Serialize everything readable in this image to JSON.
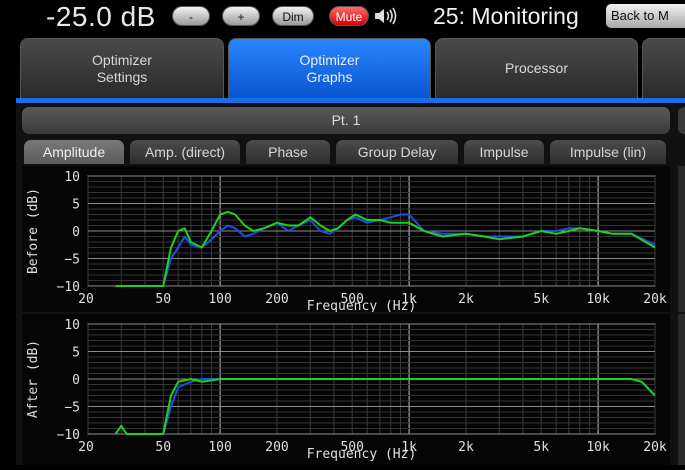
{
  "topbar": {
    "volume": "-25.0 dB",
    "minus_label": "-",
    "plus_label": "+",
    "dim_label": "Dim",
    "mute_label": "Mute",
    "speaker_icon": "speaker-volume-icon",
    "title": "25: Monitoring",
    "back_label": "Back to M"
  },
  "tabs": [
    {
      "line1": "Optimizer",
      "line2": "Settings"
    },
    {
      "line1": "Optimizer",
      "line2": "Graphs"
    },
    {
      "line1": "Processor",
      "line2": ""
    }
  ],
  "point_label": "Pt. 1",
  "subtabs": [
    "Amplitude",
    "Amp. (direct)",
    "Phase",
    "Group Delay",
    "Impulse",
    "Impulse (lin)"
  ],
  "colors": {
    "before_green": "#1fd11f",
    "after_green": "#1fd11f",
    "blue": "#1f4fe0",
    "grid": "#3a3a3a",
    "grid_major": "#bdbdbd",
    "accent": "#1a6ee8"
  },
  "charts": [
    {
      "ylabel": "Before (dB)",
      "xlabel": "Frequency (Hz)",
      "yticks": [
        "10",
        "5",
        "0",
        "−5",
        "−10"
      ],
      "xticks": [
        "20",
        "50",
        "100",
        "200",
        "500",
        "1k",
        "2k",
        "5k",
        "10k",
        "20k"
      ]
    },
    {
      "ylabel": "After (dB)",
      "xlabel": "Frequency (Hz)",
      "yticks": [
        "10",
        "5",
        "0",
        "−5",
        "−10"
      ],
      "xticks": [
        "20",
        "50",
        "100",
        "200",
        "500",
        "1k",
        "2k",
        "5k",
        "10k",
        "20k"
      ]
    }
  ],
  "chart_data": [
    {
      "type": "line",
      "xlabel": "Frequency (Hz)",
      "ylabel": "Before (dB)",
      "xscale": "log",
      "xlim": [
        20,
        20000
      ],
      "ylim": [
        -10,
        10
      ],
      "grid": true,
      "series": [
        {
          "color": "#1fd11f",
          "x": [
            28,
            50,
            55,
            60,
            65,
            70,
            80,
            90,
            100,
            110,
            120,
            135,
            150,
            170,
            200,
            230,
            260,
            300,
            340,
            380,
            420,
            470,
            520,
            600,
            700,
            800,
            900,
            1000,
            1200,
            1500,
            2000,
            2500,
            3000,
            4000,
            5000,
            6000,
            7000,
            8000,
            10000,
            12000,
            15000,
            20000
          ],
          "y": [
            -10,
            -10,
            -3,
            0,
            0.5,
            -2,
            -3,
            0,
            3,
            3.5,
            3,
            1,
            0,
            0.5,
            1.5,
            1,
            1,
            2.5,
            1,
            0,
            0.5,
            2,
            3,
            2,
            2,
            1.5,
            1.5,
            1.5,
            0,
            -1,
            -0.5,
            -1,
            -1.5,
            -1,
            0,
            -0.5,
            0,
            0.5,
            0,
            -0.5,
            -0.5,
            -3
          ]
        },
        {
          "color": "#1f4fe0",
          "x": [
            28,
            50,
            55,
            60,
            65,
            70,
            80,
            90,
            100,
            110,
            120,
            135,
            150,
            170,
            200,
            230,
            260,
            300,
            340,
            380,
            420,
            470,
            520,
            600,
            700,
            800,
            900,
            1000,
            1200,
            1500,
            2000,
            2500,
            3000,
            4000,
            5000,
            6000,
            7000,
            8000,
            10000,
            12000,
            15000,
            20000
          ],
          "y": [
            -10,
            -10,
            -5,
            -3,
            -1,
            -2.5,
            -3,
            -1.5,
            0,
            1,
            0.5,
            -1,
            -0.5,
            0.5,
            1.5,
            0,
            1,
            2,
            0,
            -0.5,
            0.5,
            2,
            2.5,
            1.5,
            2,
            2.5,
            3,
            3,
            0,
            -0.5,
            -0.5,
            -1,
            -1,
            -1,
            0,
            0,
            0.5,
            0.5,
            0,
            -0.5,
            -0.5,
            -2.5
          ]
        }
      ]
    },
    {
      "type": "line",
      "xlabel": "Frequency (Hz)",
      "ylabel": "After (dB)",
      "xscale": "log",
      "xlim": [
        20,
        20000
      ],
      "ylim": [
        -10,
        10
      ],
      "grid": true,
      "series": [
        {
          "color": "#1fd11f",
          "x": [
            28,
            30,
            32,
            50,
            55,
            60,
            70,
            80,
            100,
            150,
            200,
            300,
            500,
            1000,
            2000,
            5000,
            10000,
            15000,
            17000,
            20000
          ],
          "y": [
            -10,
            -8.5,
            -10,
            -10,
            -3,
            -0.5,
            0,
            -0.5,
            0,
            0,
            0,
            0,
            0,
            0,
            0,
            0,
            0,
            0,
            -0.5,
            -3
          ]
        },
        {
          "color": "#1f4fe0",
          "x": [
            50,
            55,
            60,
            70,
            80,
            100,
            150,
            200,
            300,
            500,
            1000,
            2000,
            5000,
            10000,
            15000,
            17000,
            20000
          ],
          "y": [
            -10,
            -5,
            -1.5,
            -0.5,
            0,
            0,
            0,
            0,
            0,
            0,
            0,
            0,
            0,
            0,
            0,
            -0.5,
            -3
          ]
        }
      ]
    }
  ]
}
